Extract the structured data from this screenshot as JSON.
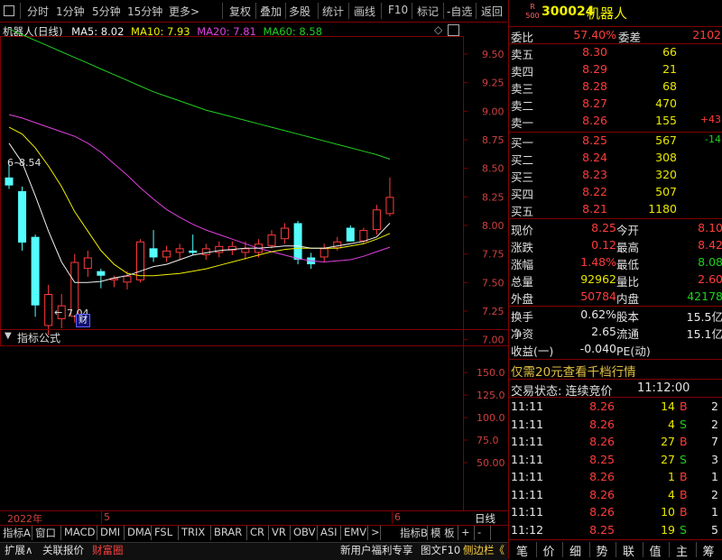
{
  "toolbar": {
    "items": [
      "分时",
      "1分钟",
      "5分钟",
      "15分钟",
      "更多>",
      "复权",
      "叠加",
      "多股",
      "统计",
      "画线",
      "F10",
      "标记",
      "-自选",
      "返回"
    ]
  },
  "chart": {
    "title": "机器人(日线)",
    "ma5": "MA5: 8.02",
    "ma10": "MA10: 7.93",
    "ma20": "MA20: 7.81",
    "ma60": "MA60: 8.58",
    "high_label": "8.54",
    "low_label": "7.04",
    "cai_tag": "财",
    "y_ticks": [
      "9.50",
      "9.25",
      "9.00",
      "8.75",
      "8.50",
      "8.25",
      "8.00",
      "7.75",
      "7.50",
      "7.25",
      "7.00"
    ],
    "date_labels": [
      "2022年",
      "5",
      "6"
    ],
    "colors": {
      "up": "#ff3c3c",
      "down": "#54fcfc",
      "ma5": "#f0f0f0",
      "ma10": "#f0f000",
      "ma20": "#e040e0",
      "ma60": "#20d020",
      "axis": "#800000"
    }
  },
  "chart_data": {
    "type": "candlestick",
    "ylim": [
      6.95,
      9.65
    ],
    "candles": [
      {
        "o": 8.42,
        "h": 8.54,
        "l": 8.32,
        "c": 8.35
      },
      {
        "o": 8.3,
        "h": 8.34,
        "l": 7.78,
        "c": 7.85
      },
      {
        "o": 7.9,
        "h": 7.92,
        "l": 7.2,
        "c": 7.3
      },
      {
        "o": 7.12,
        "h": 7.48,
        "l": 7.04,
        "c": 7.4
      },
      {
        "o": 7.18,
        "h": 7.4,
        "l": 7.1,
        "c": 7.3
      },
      {
        "o": 7.2,
        "h": 7.75,
        "l": 7.15,
        "c": 7.68
      },
      {
        "o": 7.62,
        "h": 7.78,
        "l": 7.55,
        "c": 7.72
      },
      {
        "o": 7.6,
        "h": 7.62,
        "l": 7.45,
        "c": 7.56
      },
      {
        "o": 7.52,
        "h": 7.56,
        "l": 7.46,
        "c": 7.54
      },
      {
        "o": 7.5,
        "h": 7.6,
        "l": 7.44,
        "c": 7.56
      },
      {
        "o": 7.52,
        "h": 7.88,
        "l": 7.5,
        "c": 7.86
      },
      {
        "o": 7.8,
        "h": 7.96,
        "l": 7.68,
        "c": 7.72
      },
      {
        "o": 7.72,
        "h": 7.82,
        "l": 7.68,
        "c": 7.78
      },
      {
        "o": 7.76,
        "h": 7.84,
        "l": 7.7,
        "c": 7.8
      },
      {
        "o": 7.78,
        "h": 7.92,
        "l": 7.74,
        "c": 7.76
      },
      {
        "o": 7.74,
        "h": 7.84,
        "l": 7.7,
        "c": 7.8
      },
      {
        "o": 7.76,
        "h": 7.86,
        "l": 7.72,
        "c": 7.82
      },
      {
        "o": 7.78,
        "h": 7.86,
        "l": 7.74,
        "c": 7.82
      },
      {
        "o": 7.76,
        "h": 7.86,
        "l": 7.7,
        "c": 7.8
      },
      {
        "o": 7.76,
        "h": 7.88,
        "l": 7.72,
        "c": 7.84
      },
      {
        "o": 7.82,
        "h": 7.96,
        "l": 7.8,
        "c": 7.92
      },
      {
        "o": 7.88,
        "h": 8.02,
        "l": 7.84,
        "c": 7.98
      },
      {
        "o": 8.02,
        "h": 8.04,
        "l": 7.66,
        "c": 7.7
      },
      {
        "o": 7.72,
        "h": 7.76,
        "l": 7.62,
        "c": 7.66
      },
      {
        "o": 7.72,
        "h": 7.84,
        "l": 7.68,
        "c": 7.8
      },
      {
        "o": 7.8,
        "h": 7.9,
        "l": 7.78,
        "c": 7.86
      },
      {
        "o": 7.98,
        "h": 8.0,
        "l": 7.86,
        "c": 7.86
      },
      {
        "o": 7.86,
        "h": 7.98,
        "l": 7.84,
        "c": 7.96
      },
      {
        "o": 7.96,
        "h": 8.18,
        "l": 7.92,
        "c": 8.14
      },
      {
        "o": 8.1,
        "h": 8.42,
        "l": 8.08,
        "c": 8.25
      }
    ],
    "ma5": [
      8.72,
      8.55,
      8.26,
      7.95,
      7.68,
      7.5,
      7.5,
      7.51,
      7.54,
      7.56,
      7.6,
      7.64,
      7.66,
      7.7,
      7.74,
      7.76,
      7.78,
      7.79,
      7.8,
      7.8,
      7.81,
      7.82,
      7.82,
      7.8,
      7.8,
      7.82,
      7.84,
      7.86,
      7.9,
      8.02
    ],
    "ma10": [
      8.86,
      8.8,
      8.68,
      8.52,
      8.34,
      8.12,
      7.95,
      7.78,
      7.66,
      7.58,
      7.56,
      7.56,
      7.57,
      7.58,
      7.6,
      7.62,
      7.65,
      7.68,
      7.71,
      7.74,
      7.77,
      7.79,
      7.8,
      7.8,
      7.8,
      7.8,
      7.82,
      7.84,
      7.88,
      7.93
    ],
    "ma20": [
      8.97,
      8.94,
      8.9,
      8.86,
      8.82,
      8.78,
      8.72,
      8.64,
      8.54,
      8.44,
      8.33,
      8.23,
      8.14,
      8.07,
      8.01,
      7.96,
      7.92,
      7.88,
      7.84,
      7.8,
      7.77,
      7.74,
      7.71,
      7.69,
      7.68,
      7.69,
      7.7,
      7.73,
      7.77,
      7.81
    ],
    "ma60": [
      9.72,
      9.67,
      9.62,
      9.57,
      9.52,
      9.47,
      9.42,
      9.37,
      9.32,
      9.27,
      9.22,
      9.17,
      9.13,
      9.09,
      9.05,
      9.01,
      8.98,
      8.95,
      8.92,
      8.89,
      8.86,
      8.83,
      8.8,
      8.77,
      8.74,
      8.71,
      8.68,
      8.65,
      8.62,
      8.58
    ]
  },
  "indicator": {
    "title": "指标公式",
    "y_ticks": [
      "150.0",
      "125.0",
      "100.0",
      "75.0",
      "50.00"
    ]
  },
  "bottom_tabs": [
    "指标A",
    "窗口",
    "MACD",
    "DMI",
    "DMA",
    "FSL",
    "TRIX",
    "BRAR",
    "CR",
    "VR",
    "OBV",
    "ASI",
    "EMV",
    ">",
    "指标B",
    "模 板",
    "+",
    "-"
  ],
  "day_line": "日线",
  "footer": {
    "items": [
      "扩展∧",
      "关联报价",
      "财富圈"
    ],
    "promo": "新用户福利专享",
    "f10": "图文F10",
    "side": "侧边栏《"
  },
  "quote": {
    "code": "300024",
    "name": "机器人",
    "badge_top": "R",
    "badge_bottom": "500",
    "weibi_label": "委比",
    "weibi": "57.40%",
    "weicha_label": "委差",
    "weicha": "2102",
    "asks": [
      {
        "label": "卖五",
        "price": "8.30",
        "vol": "66",
        "chg": ""
      },
      {
        "label": "卖四",
        "price": "8.29",
        "vol": "21",
        "chg": ""
      },
      {
        "label": "卖三",
        "price": "8.28",
        "vol": "68",
        "chg": ""
      },
      {
        "label": "卖二",
        "price": "8.27",
        "vol": "470",
        "chg": ""
      },
      {
        "label": "卖一",
        "price": "8.26",
        "vol": "155",
        "chg": "+43"
      }
    ],
    "bids": [
      {
        "label": "买一",
        "price": "8.25",
        "vol": "567",
        "chg": "-14"
      },
      {
        "label": "买二",
        "price": "8.24",
        "vol": "308",
        "chg": ""
      },
      {
        "label": "买三",
        "price": "8.23",
        "vol": "320",
        "chg": ""
      },
      {
        "label": "买四",
        "price": "8.22",
        "vol": "507",
        "chg": ""
      },
      {
        "label": "买五",
        "price": "8.21",
        "vol": "1180",
        "chg": ""
      }
    ],
    "stats": [
      {
        "l1": "现价",
        "v1": "8.25",
        "l2": "今开",
        "v2": "8.10"
      },
      {
        "l1": "涨跌",
        "v1": "0.12",
        "l2": "最高",
        "v2": "8.42"
      },
      {
        "l1": "涨幅",
        "v1": "1.48%",
        "l2": "最低",
        "v2": "8.08"
      },
      {
        "l1": "总量",
        "v1": "92962",
        "l2": "量比",
        "v2": "2.60"
      },
      {
        "l1": "外盘",
        "v1": "50784",
        "l2": "内盘",
        "v2": "42178"
      }
    ],
    "fin": [
      {
        "l1": "换手",
        "v1": "0.62%",
        "l2": "股本",
        "v2": "15.5亿"
      },
      {
        "l1": "净资",
        "v1": "2.65",
        "l2": "流通",
        "v2": "15.1亿"
      },
      {
        "l1": "收益(一)",
        "v1": "-0.040",
        "l2": "PE(动)",
        "v2": ""
      }
    ],
    "promo": "仅需20元查看千档行情",
    "status_label": "交易状态: 连续竞价",
    "status_time": "11:12:00",
    "ticks": [
      {
        "t": "11:11",
        "p": "8.26",
        "v": "14",
        "s": "B",
        "n": "2"
      },
      {
        "t": "11:11",
        "p": "8.26",
        "v": "4",
        "s": "S",
        "n": "2"
      },
      {
        "t": "11:11",
        "p": "8.26",
        "v": "27",
        "s": "B",
        "n": "7"
      },
      {
        "t": "11:11",
        "p": "8.25",
        "v": "27",
        "s": "S",
        "n": "3"
      },
      {
        "t": "11:11",
        "p": "8.26",
        "v": "1",
        "s": "B",
        "n": "1"
      },
      {
        "t": "11:11",
        "p": "8.26",
        "v": "4",
        "s": "B",
        "n": "2"
      },
      {
        "t": "11:11",
        "p": "8.26",
        "v": "10",
        "s": "B",
        "n": "1"
      },
      {
        "t": "11:12",
        "p": "8.25",
        "v": "19",
        "s": "S",
        "n": "5"
      }
    ],
    "bottom_tabs": [
      "笔",
      "价",
      "细",
      "势",
      "联",
      "值",
      "主",
      "筹"
    ]
  }
}
